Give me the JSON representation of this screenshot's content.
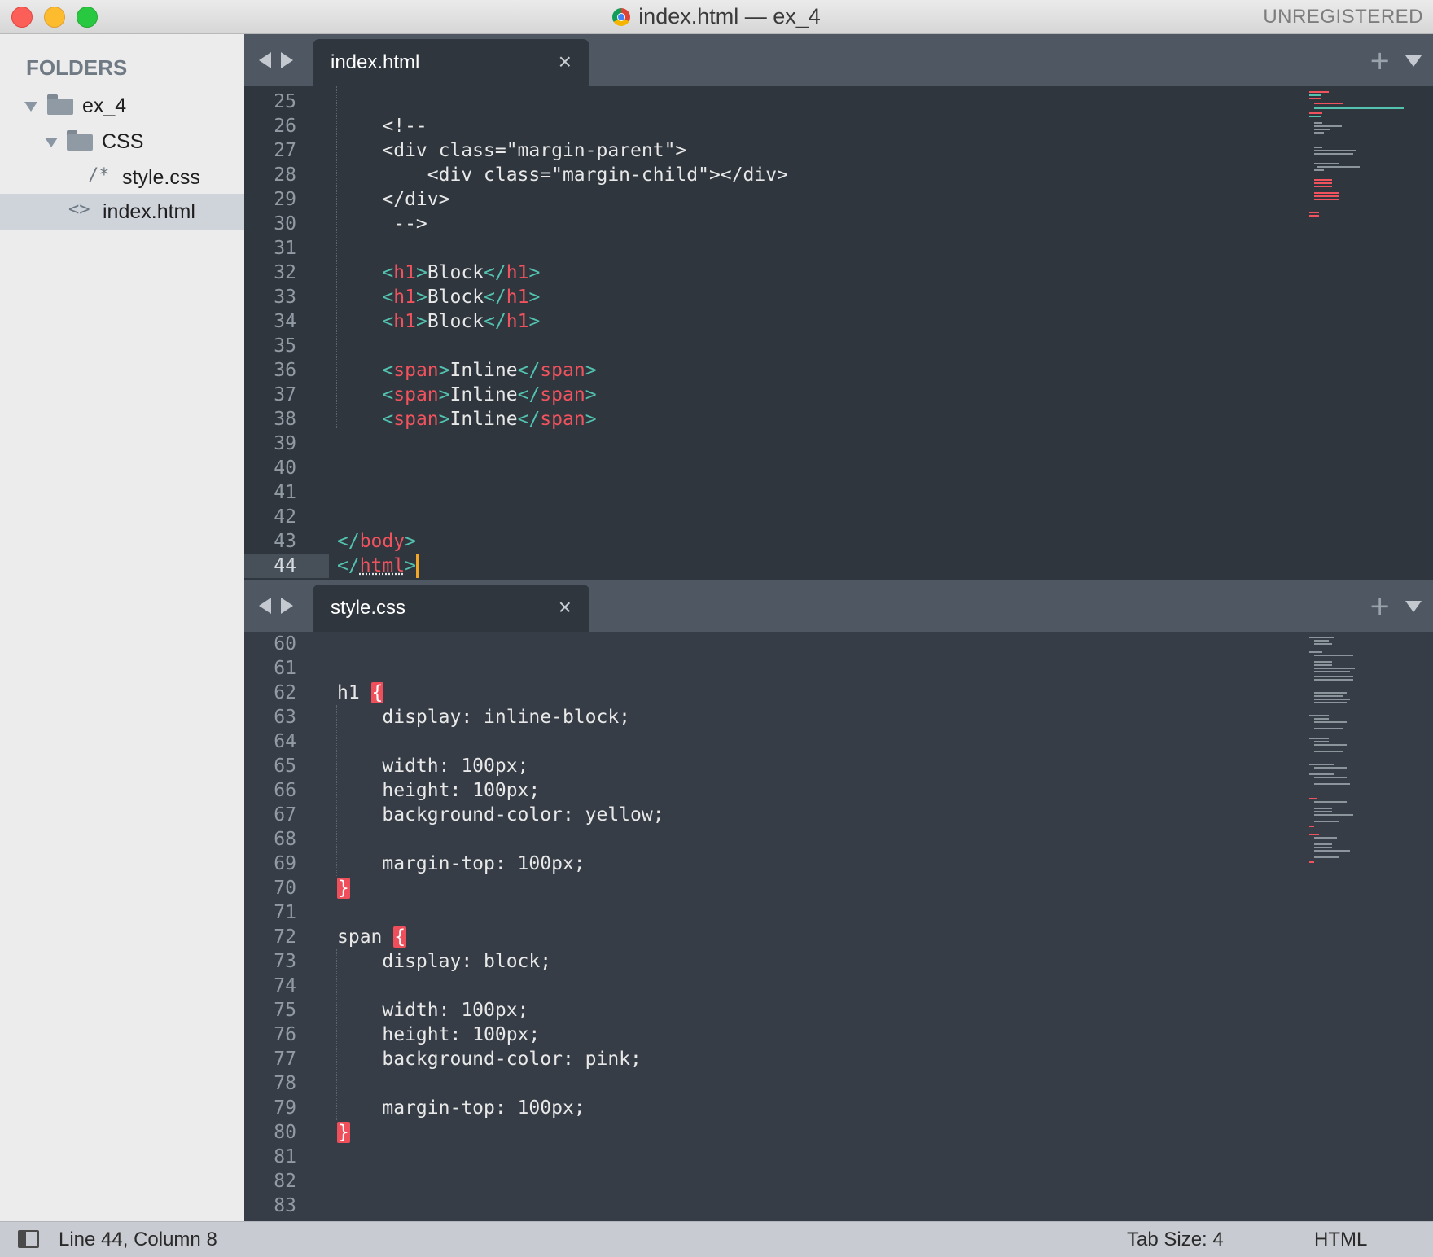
{
  "window": {
    "title": "index.html — ex_4",
    "registration": "UNREGISTERED"
  },
  "sidebar": {
    "header": "FOLDERS",
    "tree": [
      {
        "label": "ex_4",
        "kind": "folder",
        "depth": 0
      },
      {
        "label": "CSS",
        "kind": "folder",
        "depth": 1
      },
      {
        "label": "style.css",
        "kind": "file",
        "glyph": "/*",
        "depth": 2
      },
      {
        "label": "index.html",
        "kind": "file",
        "glyph": "<>",
        "depth": 1,
        "selected": true
      }
    ]
  },
  "panes": [
    {
      "tab": {
        "label": "index.html",
        "close": "×"
      },
      "plus": "+",
      "current_line": 44,
      "lines": [
        {
          "n": "25",
          "tokens": []
        },
        {
          "n": "26",
          "tokens": [
            {
              "t": "    <!--",
              "c": "plain"
            }
          ]
        },
        {
          "n": "27",
          "tokens": [
            {
              "t": "    <div class=\"margin-parent\">",
              "c": "plain"
            }
          ]
        },
        {
          "n": "28",
          "tokens": [
            {
              "t": "        <div class=\"margin-child\"></div>",
              "c": "plain"
            }
          ]
        },
        {
          "n": "29",
          "tokens": [
            {
              "t": "    </div>",
              "c": "plain"
            }
          ]
        },
        {
          "n": "30",
          "tokens": [
            {
              "t": "     -->",
              "c": "plain"
            }
          ]
        },
        {
          "n": "31",
          "tokens": []
        },
        {
          "n": "32",
          "tokens": [
            {
              "t": "    ",
              "c": "plain"
            },
            {
              "t": "<",
              "c": "tg"
            },
            {
              "t": "h1",
              "c": "tn"
            },
            {
              "t": ">",
              "c": "tg"
            },
            {
              "t": "Block",
              "c": "plain"
            },
            {
              "t": "</",
              "c": "tg"
            },
            {
              "t": "h1",
              "c": "tn"
            },
            {
              "t": ">",
              "c": "tg"
            }
          ]
        },
        {
          "n": "33",
          "tokens": [
            {
              "t": "    ",
              "c": "plain"
            },
            {
              "t": "<",
              "c": "tg"
            },
            {
              "t": "h1",
              "c": "tn"
            },
            {
              "t": ">",
              "c": "tg"
            },
            {
              "t": "Block",
              "c": "plain"
            },
            {
              "t": "</",
              "c": "tg"
            },
            {
              "t": "h1",
              "c": "tn"
            },
            {
              "t": ">",
              "c": "tg"
            }
          ]
        },
        {
          "n": "34",
          "tokens": [
            {
              "t": "    ",
              "c": "plain"
            },
            {
              "t": "<",
              "c": "tg"
            },
            {
              "t": "h1",
              "c": "tn"
            },
            {
              "t": ">",
              "c": "tg"
            },
            {
              "t": "Block",
              "c": "plain"
            },
            {
              "t": "</",
              "c": "tg"
            },
            {
              "t": "h1",
              "c": "tn"
            },
            {
              "t": ">",
              "c": "tg"
            }
          ]
        },
        {
          "n": "35",
          "tokens": []
        },
        {
          "n": "36",
          "tokens": [
            {
              "t": "    ",
              "c": "plain"
            },
            {
              "t": "<",
              "c": "tg"
            },
            {
              "t": "span",
              "c": "tn"
            },
            {
              "t": ">",
              "c": "tg"
            },
            {
              "t": "Inline",
              "c": "plain"
            },
            {
              "t": "</",
              "c": "tg"
            },
            {
              "t": "span",
              "c": "tn"
            },
            {
              "t": ">",
              "c": "tg"
            }
          ]
        },
        {
          "n": "37",
          "tokens": [
            {
              "t": "    ",
              "c": "plain"
            },
            {
              "t": "<",
              "c": "tg"
            },
            {
              "t": "span",
              "c": "tn"
            },
            {
              "t": ">",
              "c": "tg"
            },
            {
              "t": "Inline",
              "c": "plain"
            },
            {
              "t": "</",
              "c": "tg"
            },
            {
              "t": "span",
              "c": "tn"
            },
            {
              "t": ">",
              "c": "tg"
            }
          ]
        },
        {
          "n": "38",
          "tokens": [
            {
              "t": "    ",
              "c": "plain"
            },
            {
              "t": "<",
              "c": "tg"
            },
            {
              "t": "span",
              "c": "tn"
            },
            {
              "t": ">",
              "c": "tg"
            },
            {
              "t": "Inline",
              "c": "plain"
            },
            {
              "t": "</",
              "c": "tg"
            },
            {
              "t": "span",
              "c": "tn"
            },
            {
              "t": ">",
              "c": "tg"
            }
          ]
        },
        {
          "n": "39",
          "tokens": []
        },
        {
          "n": "40",
          "tokens": []
        },
        {
          "n": "41",
          "tokens": []
        },
        {
          "n": "42",
          "tokens": []
        },
        {
          "n": "43",
          "tokens": [
            {
              "t": "</",
              "c": "tg"
            },
            {
              "t": "body",
              "c": "tn"
            },
            {
              "t": ">",
              "c": "tg"
            }
          ]
        },
        {
          "n": "44",
          "tokens": [
            {
              "t": "</",
              "c": "tg"
            },
            {
              "t": "html",
              "c": "tn squig"
            },
            {
              "t": ">",
              "c": "tg"
            },
            {
              "t": "",
              "c": "caret"
            }
          ]
        }
      ]
    },
    {
      "tab": {
        "label": "style.css",
        "close": "×"
      },
      "plus": "+",
      "current_line": 0,
      "lines": [
        {
          "n": "60",
          "tokens": []
        },
        {
          "n": "61",
          "tokens": []
        },
        {
          "n": "62",
          "tokens": [
            {
              "t": "h1 ",
              "c": "plain"
            },
            {
              "t": "{",
              "c": "brace"
            }
          ]
        },
        {
          "n": "63",
          "tokens": [
            {
              "t": "    display: inline-block;",
              "c": "plain"
            }
          ]
        },
        {
          "n": "64",
          "tokens": []
        },
        {
          "n": "65",
          "tokens": [
            {
              "t": "    width: 100px;",
              "c": "plain"
            }
          ]
        },
        {
          "n": "66",
          "tokens": [
            {
              "t": "    height: 100px;",
              "c": "plain"
            }
          ]
        },
        {
          "n": "67",
          "tokens": [
            {
              "t": "    background-color: yellow;",
              "c": "plain"
            }
          ]
        },
        {
          "n": "68",
          "tokens": []
        },
        {
          "n": "69",
          "tokens": [
            {
              "t": "    margin-top: 100px;",
              "c": "plain"
            }
          ]
        },
        {
          "n": "70",
          "tokens": [
            {
              "t": "}",
              "c": "brace"
            }
          ]
        },
        {
          "n": "71",
          "tokens": []
        },
        {
          "n": "72",
          "tokens": [
            {
              "t": "span ",
              "c": "plain"
            },
            {
              "t": "{",
              "c": "brace"
            }
          ]
        },
        {
          "n": "73",
          "tokens": [
            {
              "t": "    display: block;",
              "c": "plain"
            }
          ]
        },
        {
          "n": "74",
          "tokens": []
        },
        {
          "n": "75",
          "tokens": [
            {
              "t": "    width: 100px;",
              "c": "plain"
            }
          ]
        },
        {
          "n": "76",
          "tokens": [
            {
              "t": "    height: 100px;",
              "c": "plain"
            }
          ]
        },
        {
          "n": "77",
          "tokens": [
            {
              "t": "    background-color: pink;",
              "c": "plain"
            }
          ]
        },
        {
          "n": "78",
          "tokens": []
        },
        {
          "n": "79",
          "tokens": [
            {
              "t": "    margin-top: 100px;",
              "c": "plain"
            }
          ]
        },
        {
          "n": "80",
          "tokens": [
            {
              "t": "}",
              "c": "brace"
            }
          ]
        },
        {
          "n": "81",
          "tokens": []
        },
        {
          "n": "82",
          "tokens": []
        },
        {
          "n": "83",
          "tokens": []
        }
      ]
    }
  ],
  "statusbar": {
    "position": "Line 44, Column 8",
    "tab_size": "Tab Size: 4",
    "syntax": "HTML"
  },
  "colors": {
    "editor_bg": "#2f363e",
    "tag_bracket": "#53c3b0",
    "tag_name": "#f0535d",
    "caret": "#f1a627",
    "modified_gutter": "#8ec38a"
  }
}
